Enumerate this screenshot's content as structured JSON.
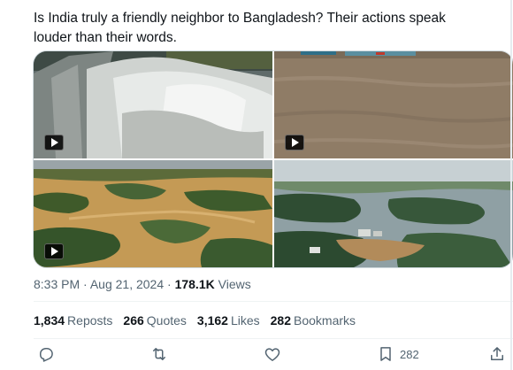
{
  "tweet": {
    "text_line1": "Is India truly a friendly neighbor to Bangladesh? Their actions speak",
    "text_line2": "louder than their words."
  },
  "media": [
    {
      "label": "video-dam-spillway",
      "has_video": true
    },
    {
      "label": "video-flood-water",
      "has_video": true
    },
    {
      "label": "video-aerial-flood-fields",
      "has_video": true
    },
    {
      "label": "image-aerial-flood-village",
      "has_video": false
    }
  ],
  "meta": {
    "time": "8:33 PM",
    "separator": "·",
    "date": "Aug 21, 2024",
    "views_count": "178.1K",
    "views_label": "Views"
  },
  "stats": {
    "reposts_count": "1,834",
    "reposts_label": "Reposts",
    "quotes_count": "266",
    "quotes_label": "Quotes",
    "likes_count": "3,162",
    "likes_label": "Likes",
    "bookmarks_count": "282",
    "bookmarks_label": "Bookmarks"
  },
  "actions": {
    "reply_icon": "reply-icon",
    "repost_icon": "repost-icon",
    "like_icon": "heart-icon",
    "bookmark_icon": "bookmark-icon",
    "bookmark_count": "282",
    "share_icon": "share-icon"
  },
  "colors": {
    "text": "#0f1419",
    "secondary": "#536471",
    "border": "#cfd9de"
  }
}
